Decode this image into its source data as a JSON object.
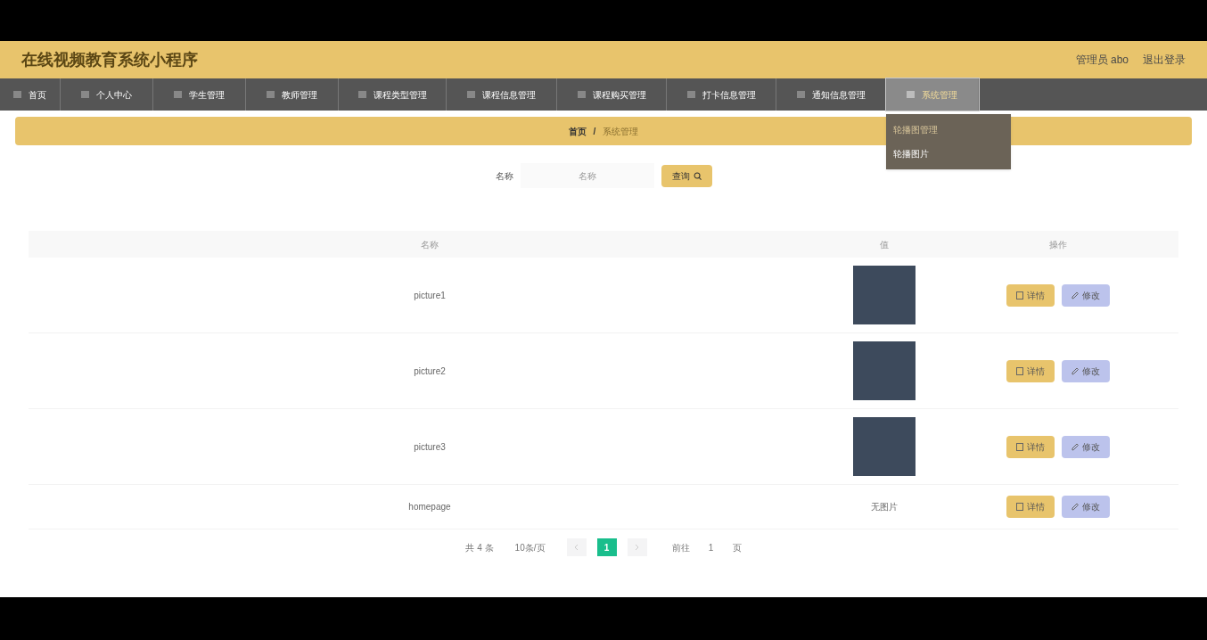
{
  "header": {
    "title": "在线视频教育系统小程序",
    "user": "管理员 abo",
    "logout": "退出登录"
  },
  "nav": [
    {
      "label": "首页",
      "selected": false
    },
    {
      "label": "个人中心",
      "selected": false
    },
    {
      "label": "学生管理",
      "selected": false
    },
    {
      "label": "教师管理",
      "selected": false
    },
    {
      "label": "课程类型管理",
      "selected": false
    },
    {
      "label": "课程信息管理",
      "selected": false
    },
    {
      "label": "课程购买管理",
      "selected": false
    },
    {
      "label": "打卡信息管理",
      "selected": false
    },
    {
      "label": "通知信息管理",
      "selected": false
    },
    {
      "label": "系统管理",
      "selected": true,
      "expanded": true,
      "menu": [
        {
          "label": "轮播图管理",
          "selected": true
        },
        {
          "label": "轮播图片",
          "selected": false
        }
      ]
    }
  ],
  "breadcrumb": [
    "首页",
    "/",
    "系统管理"
  ],
  "search": {
    "label": "名称",
    "placeholder": "名称",
    "button": "查询"
  },
  "table": {
    "columns": [
      "名称",
      "值",
      "操作"
    ],
    "rows": [
      {
        "name": "picture1",
        "value": {
          "kind": "image"
        },
        "actions": [
          "详情",
          "修改"
        ]
      },
      {
        "name": "picture2",
        "value": {
          "kind": "image"
        },
        "actions": [
          "详情",
          "修改"
        ]
      },
      {
        "name": "picture3",
        "value": {
          "kind": "image"
        },
        "actions": [
          "详情",
          "修改"
        ]
      },
      {
        "name": "homepage",
        "value": {
          "kind": "text",
          "text": "无图片"
        },
        "actions": [
          "详情",
          "修改"
        ]
      }
    ]
  },
  "pagination": {
    "total": "共 4 条",
    "page_size": "10条/页",
    "pages": [
      {
        "label": "1",
        "selected": true
      }
    ],
    "goto": "前往",
    "goto_value": "1",
    "goto_suffix": "页"
  }
}
